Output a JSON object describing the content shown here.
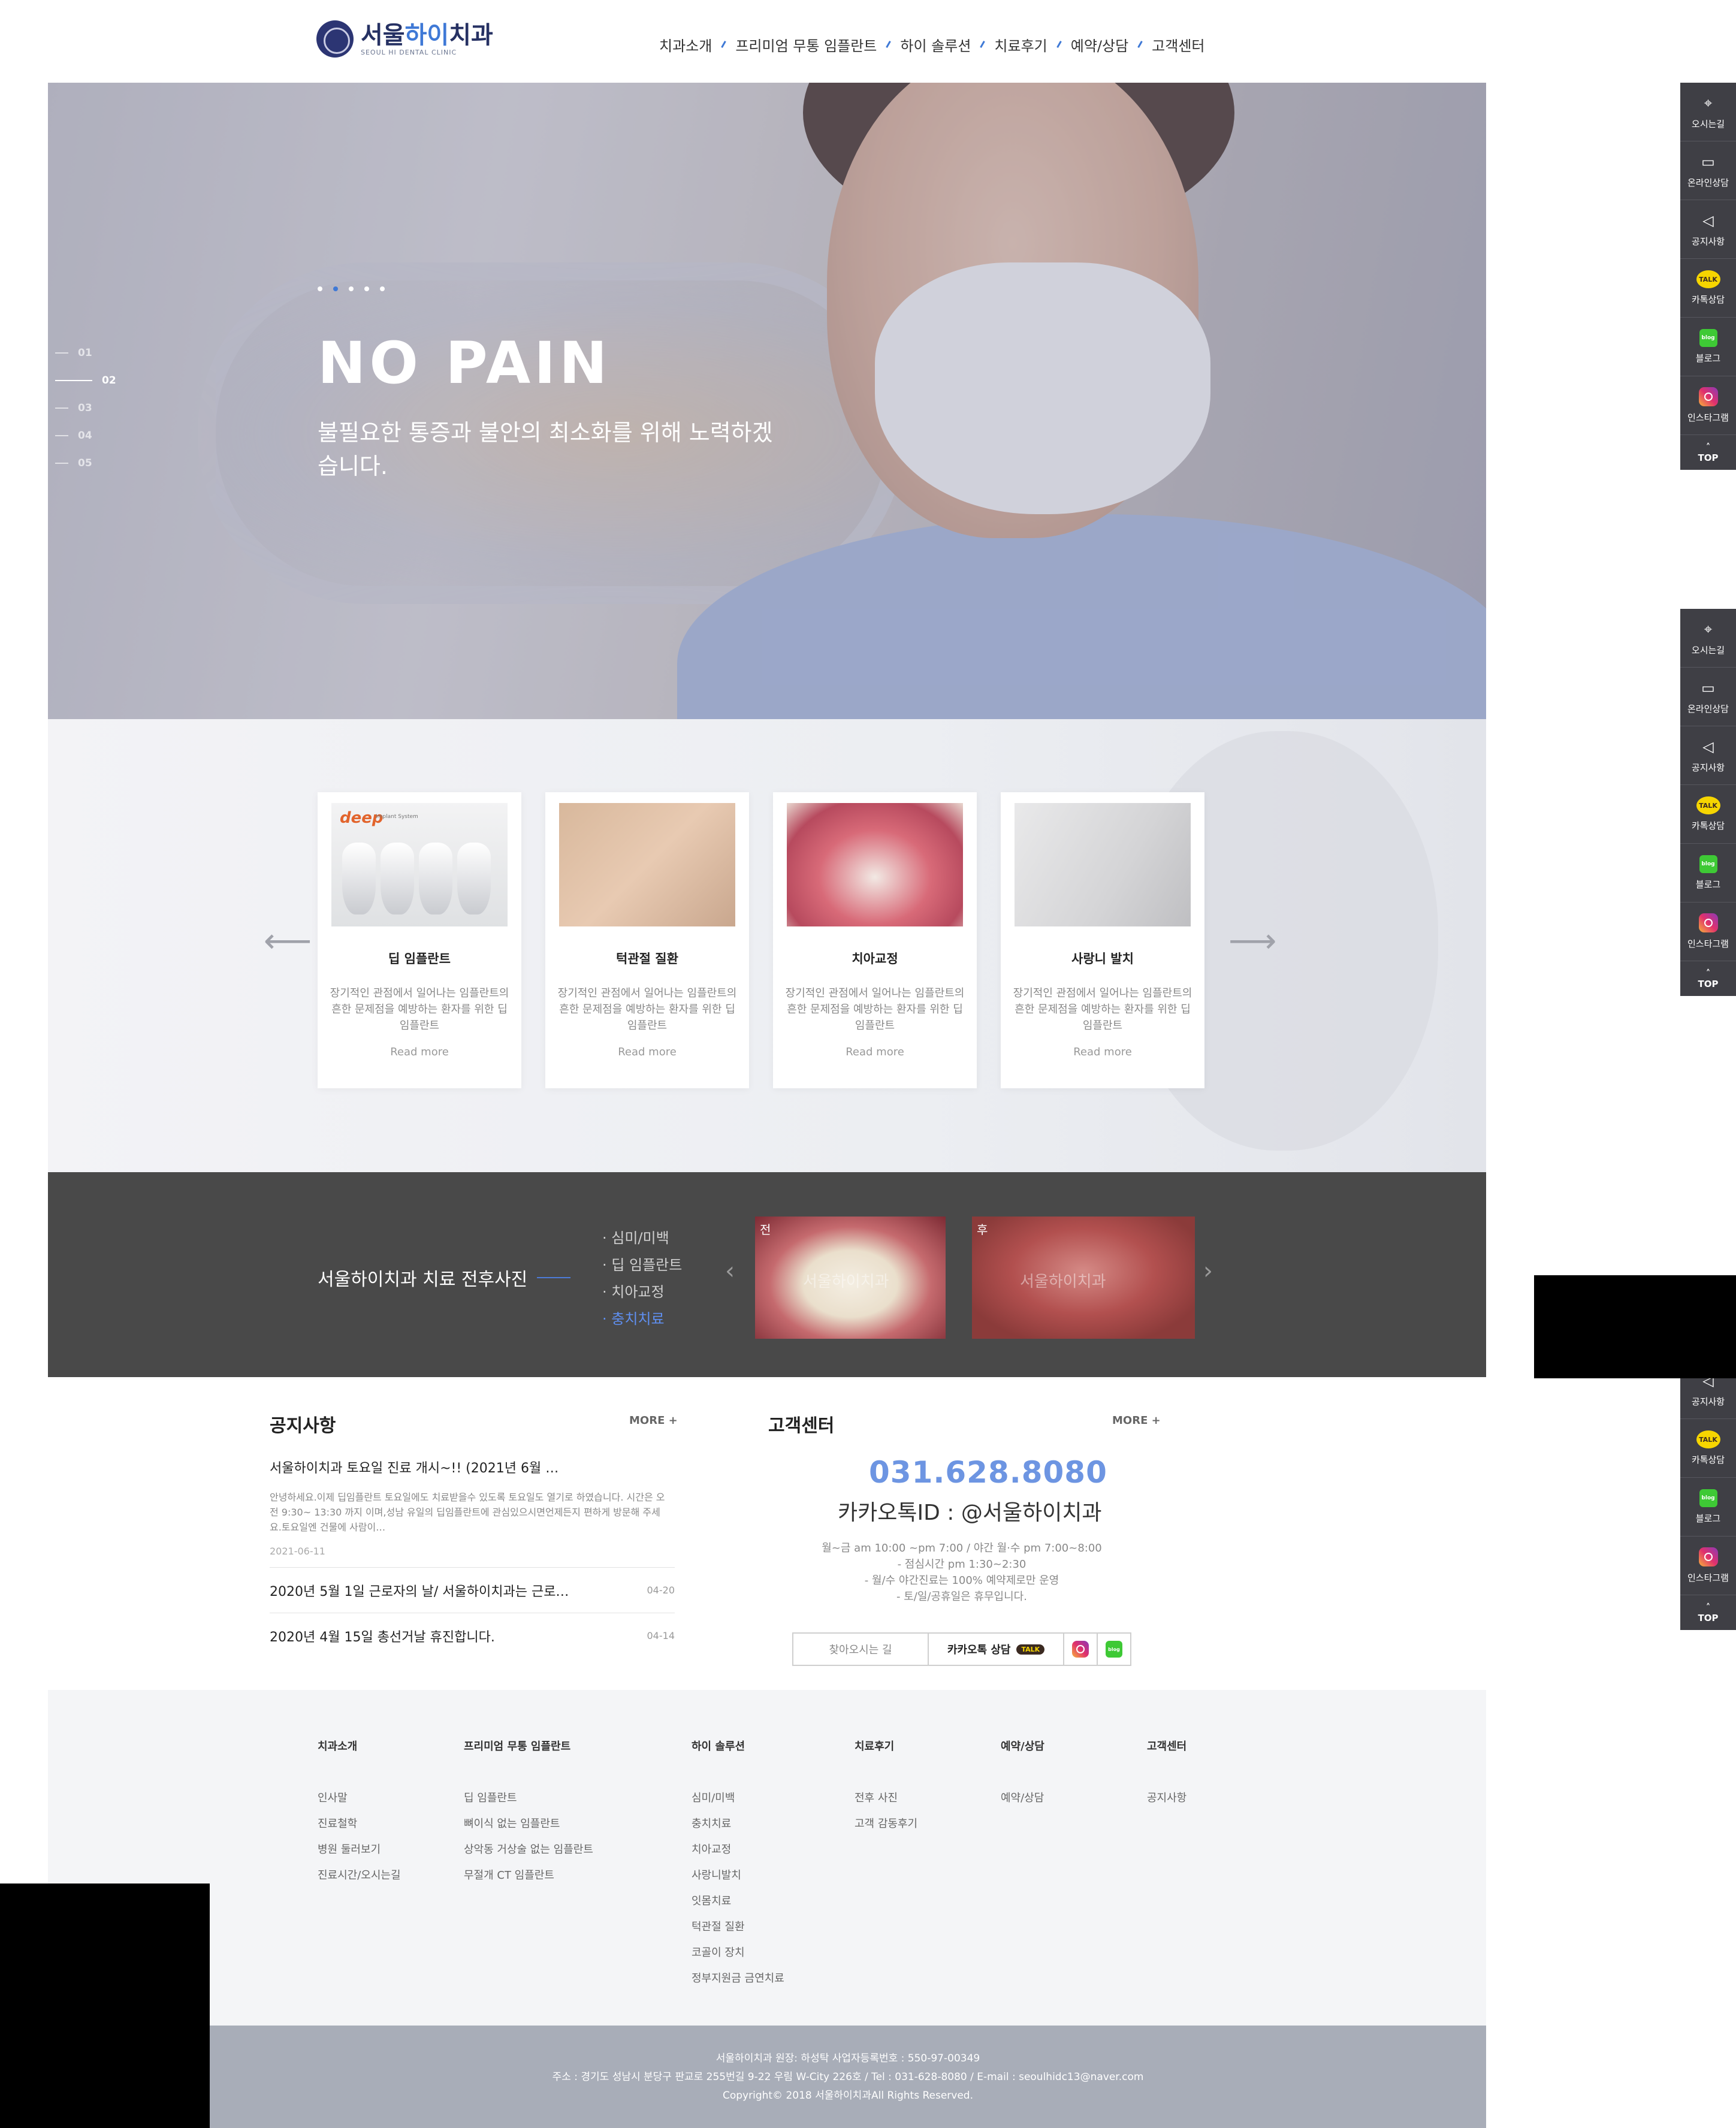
{
  "header": {
    "logo_ko_a": "서울",
    "logo_ko_b": "하이",
    "logo_ko_c": "치과",
    "logo_en": "SEOUL HI DENTAL CLINIC",
    "nav": [
      "치과소개",
      "프리미엄 무통 임플란트",
      "하이 솔루션",
      "치료후기",
      "예약/상담",
      "고객센터"
    ]
  },
  "hero": {
    "title": "NO PAIN",
    "subtitle": "불필요한 통증과 불안의 최소화를 위해 노력하겠습니다.",
    "pager": [
      "01",
      "02",
      "03",
      "04",
      "05"
    ],
    "active_slide": "02"
  },
  "treatments": {
    "cards": [
      {
        "title": "딥 임플란트",
        "desc": "장기적인 관점에서 일어나는 임플란트의 흔한 문제점을 예방하는 환자를 위한 딥 임플란트",
        "more": "Read more",
        "brand": "deep",
        "brand_sub": "Implant System"
      },
      {
        "title": "턱관절 질환",
        "desc": "장기적인 관점에서 일어나는 임플란트의 흔한 문제점을 예방하는 환자를 위한 딥 임플란트",
        "more": "Read more"
      },
      {
        "title": "치아교정",
        "desc": "장기적인 관점에서 일어나는 임플란트의 흔한 문제점을 예방하는 환자를 위한 딥 임플란트",
        "more": "Read more"
      },
      {
        "title": "사랑니 발치",
        "desc": "장기적인 관점에서 일어나는 임플란트의 흔한 문제점을 예방하는 환자를 위한 딥 임플란트",
        "more": "Read more"
      }
    ]
  },
  "before_after": {
    "title": "서울하이치과 치료 전후사진",
    "categories": [
      "· 심미/미백",
      "· 딥 임플란트",
      "· 치아교정",
      "· 충치치료"
    ],
    "active_category": "· 충치치료",
    "photo_tags": [
      "전",
      "후"
    ],
    "watermark": "서울하이치과"
  },
  "notice": {
    "heading": "공지사항",
    "more": "MORE +",
    "first": {
      "title": "서울하이치과 토요일 진료 개시~!! (2021년 6월 …",
      "body": "안녕하세요.이제 딥임플란트 토요일에도 치료받을수 있도록 토요일도 열기로 하였습니다. 시간은 오전 9:30~ 13:30 까지 이며,성남 유일의 딥임플란트에 관심있으시면언제든지 편하게 방문해 주세요.토요일엔 건물에 사람이…",
      "date": "2021-06-11"
    },
    "rows": [
      {
        "title": "2020년 5월 1일 근로자의 날/ 서울하이치과는 근로…",
        "date": "04-20"
      },
      {
        "title": "2020년 4월 15일 총선거날 휴진합니다.",
        "date": "04-14"
      }
    ]
  },
  "customer": {
    "heading": "고객센터",
    "more": "MORE +",
    "phone": "031.628.8080",
    "kakao_id": "카카오톡ID : @서울하이치과",
    "hours": [
      "월~금 am 10:00 ~pm 7:00 / 야간 월·수 pm 7:00~8:00",
      "- 점심시간 pm 1:30~2:30",
      "- 월/수 야간진료는 100% 예약제로만 운영",
      "- 토/일/공휴일은 휴무입니다."
    ],
    "btn_map": "찾아오시는 길",
    "btn_kakao": "카카오톡 상담",
    "talk_badge": "TALK",
    "blog_badge": "blog"
  },
  "footer": {
    "columns": [
      {
        "head": "치과소개",
        "links": [
          "인사말",
          "진료철학",
          "병원 둘러보기",
          "진료시간/오시는길"
        ]
      },
      {
        "head": "프리미엄 무통 임플란트",
        "links": [
          "딥 임플란트",
          "뼈이식 없는 임플란트",
          "상악동 거상술 없는 임플란트",
          "무절개 CT 임플란트"
        ]
      },
      {
        "head": "하이 솔루션",
        "links": [
          "심미/미백",
          "충치치료",
          "치아교정",
          "사랑니발치",
          "잇몸치료",
          "턱관절 질환",
          "코골이 장치",
          "정부지원금 금연치료"
        ]
      },
      {
        "head": "치료후기",
        "links": [
          "전후 사진",
          "고객 감동후기"
        ]
      },
      {
        "head": "예약/상담",
        "links": [
          "예약/상담"
        ]
      },
      {
        "head": "고객센터",
        "links": [
          "공지사항"
        ]
      }
    ],
    "copy": [
      "서울하이치과 원장: 하성탁 사업자등록번호 : 550-97-00349",
      "주소 : 경기도 성남시 분당구 판교로 255번길 9-22 우림 W-City 226호 / Tel : 031-628-8080 / E-mail : seoulhidc13@naver.com",
      "Copyright© 2018 서울하이치과All Rights Reserved."
    ]
  },
  "quick_menu": {
    "items": [
      {
        "label": "오시는길",
        "icon": "map-pin-icon"
      },
      {
        "label": "온라인상담",
        "icon": "chat-icon"
      },
      {
        "label": "공지사항",
        "icon": "megaphone-icon"
      },
      {
        "label": "카톡상담",
        "icon": "kakaotalk-icon",
        "badge": "TALK"
      },
      {
        "label": "블로그",
        "icon": "blog-icon",
        "badge": "blog"
      },
      {
        "label": "인스타그램",
        "icon": "instagram-icon"
      }
    ],
    "top": "TOP"
  },
  "colors": {
    "accent": "#3f79d6",
    "phone": "#6d95e2",
    "dark_band": "#494949",
    "quick_bg": "#3f3f45",
    "copy_bg": "#a8adb8"
  }
}
